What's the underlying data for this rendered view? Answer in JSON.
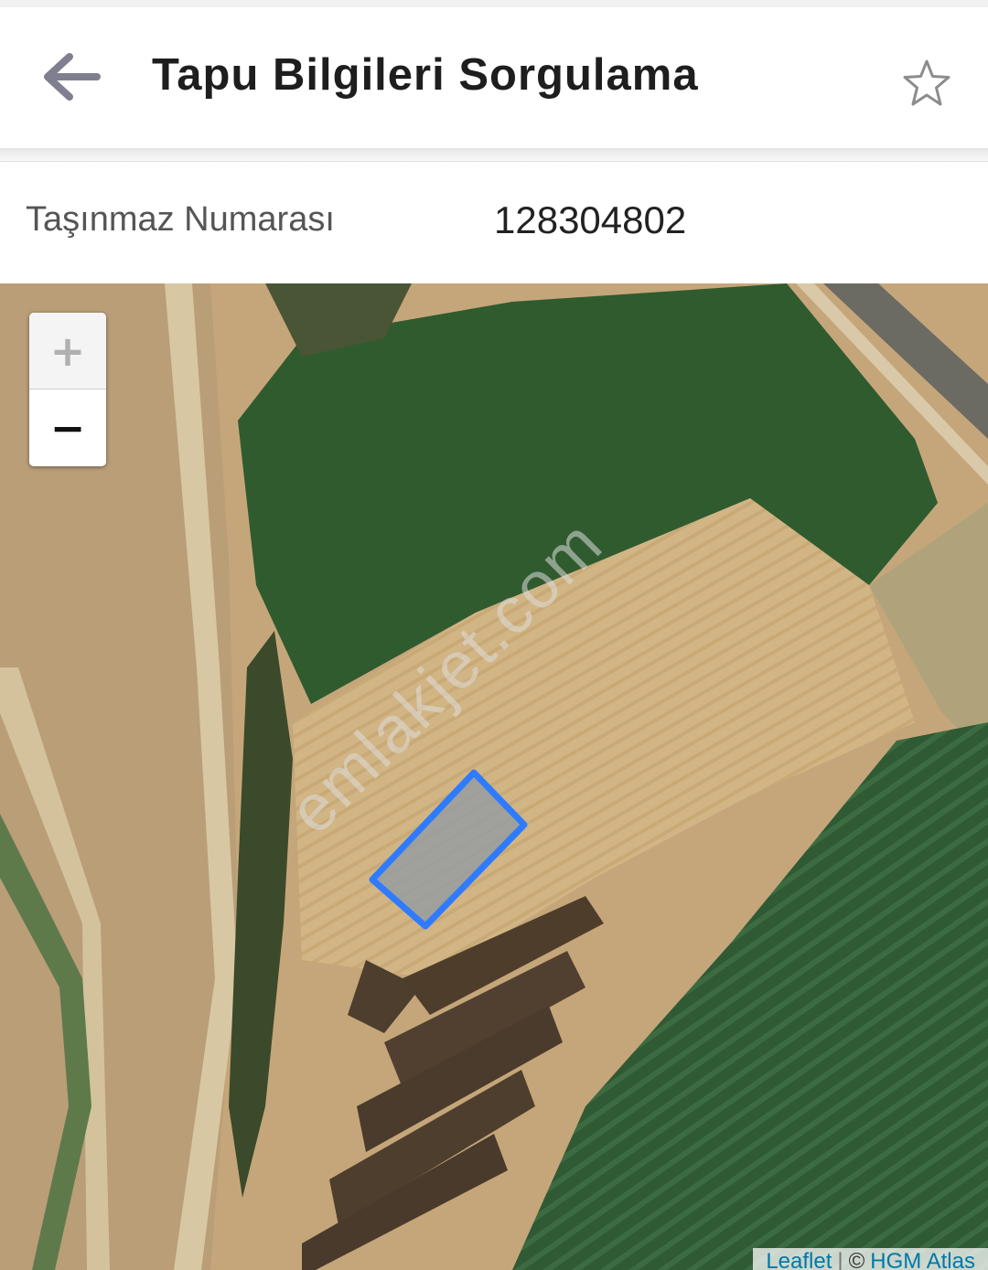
{
  "header": {
    "title": "Tapu Bilgileri Sorgulama",
    "back_icon": "arrow-left-icon",
    "favorite_icon": "star-outline-icon"
  },
  "info": {
    "label": "Taşınmaz Numarası",
    "value": "128304802"
  },
  "map": {
    "zoom_in_label": "+",
    "zoom_out_label": "−",
    "watermark": "emlakjet.com",
    "attribution": {
      "leaflet": "Leaflet",
      "separator": "|",
      "copyright": "©",
      "provider": "HGM Atlas"
    },
    "parcel_color": "#2f7bff"
  }
}
